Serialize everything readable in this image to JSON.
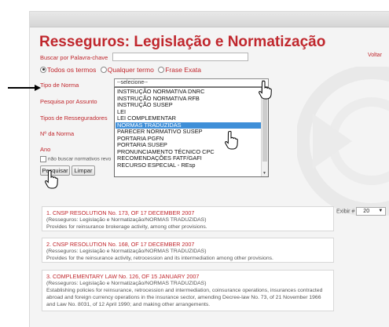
{
  "page": {
    "title": "Resseguros: Legislação e Normatização",
    "back_link": "Voltar"
  },
  "search": {
    "keyword_label": "Buscar por Palavra-chave",
    "keyword_value": "",
    "match_options": [
      "Todos os termos",
      "Qualquer termo",
      "Frase Exata"
    ],
    "match_selected": "Todos os termos"
  },
  "fields": {
    "norm_type_label": "Tipo de Norma",
    "subject_label": "Pesquisa por Assunto",
    "reinsurer_type_label": "Tipos de Resseguradores",
    "norm_number_label": "Nº da Norma",
    "year_label": "Ano",
    "revoked_checkbox_label": "não buscar normativos revo"
  },
  "norm_type_select": {
    "selected": "--selecione--",
    "options": [
      "INSTRUÇÃO NORMATIVA DNRC",
      "INSTRUÇÃO NORMATIVA RFB",
      "INSTRUÇÃO SUSEP",
      "LEI",
      "LEI COMPLEMENTAR",
      "NORMAS TRADUZIDAS",
      "PARECER NORMATIVO SUSEP",
      "PORTARIA PGFN",
      "PORTARIA SUSEP",
      "PRONUNCIAMENTO TÉCNICO CPC",
      "RECOMENDAÇÕES FATF/GAFI",
      "RECURSO ESPECIAL - REsp"
    ],
    "highlighted": "NORMAS TRADUZIDAS"
  },
  "buttons": {
    "search": "Pesquisar",
    "clear": "Limpar"
  },
  "pagination": {
    "label": "Exibir #",
    "value": "20"
  },
  "results": [
    {
      "title": "1. CNSP RESOLUTION No. 173, OF 17 DECEMBER 2007",
      "category": "(Resseguros: Legislação e Normatização/NORMAS TRADUZIDAS)",
      "description": "Provides for reinsurance brokerage activity, among other provisions."
    },
    {
      "title": "2. CNSP RESOLUTION No. 168, OF 17 DECEMBER 2007",
      "category": "(Resseguros: Legislação e Normatização/NORMAS TRADUZIDAS)",
      "description": "Provides for the reinsurance activity, retrocession and its intermediation among other provisions."
    },
    {
      "title": "3. COMPLEMENTARY LAW No. 126, OF 15 JANUARY 2007",
      "category": "(Resseguros: Legislação e Normatização/NORMAS TRADUZIDAS)",
      "description": "Establishing policies for reinsurance, retrocession and intermediation, coinsurance operations, insurances contracted abroad and foreign currency operations in the insurance sector, amending Decree-law No. 73, of 21 November 1966 and Law No. 8031, of 12 April 1990; and making other arrangements."
    }
  ],
  "colors": {
    "accent": "#c0272d",
    "highlight": "#3f8fd8"
  }
}
